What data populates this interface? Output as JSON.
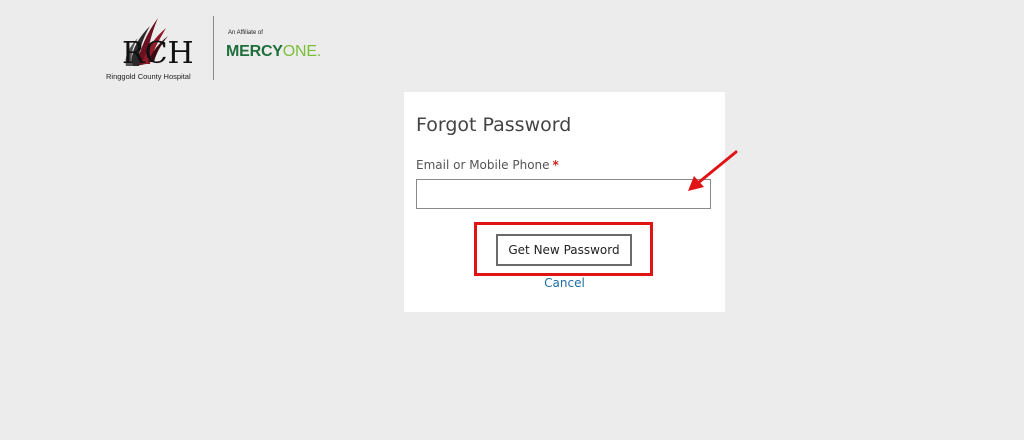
{
  "header": {
    "logo_letters": "RCH",
    "hospital_name": "Ringgold County Hospital",
    "affiliate_text": "An Affiliate of",
    "partner_name_part1": "MERCY",
    "partner_name_part2": "ONE",
    "partner_suffix": "."
  },
  "form": {
    "title": "Forgot Password",
    "email_label": "Email or Mobile Phone",
    "required_mark": "*",
    "email_value": "",
    "submit_label": "Get New Password",
    "cancel_label": "Cancel"
  },
  "colors": {
    "background": "#ececec",
    "card": "#ffffff",
    "link": "#1d6da3",
    "required": "#cc1f1f",
    "annotation_red": "#e01414",
    "brand_dark_green": "#1f6f3a",
    "brand_light_green": "#7bbf3a",
    "rch_dark_red": "#6b1020"
  }
}
